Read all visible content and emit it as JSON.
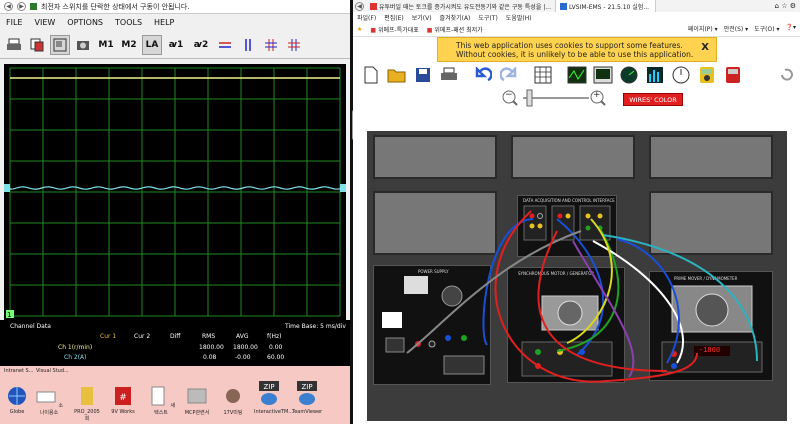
{
  "left_window": {
    "title": "최전자 스위치를 단락한 상태에서 구동이 안됩니다.",
    "menu": [
      "FILE",
      "VIEW",
      "OPTIONS",
      "TOOLS",
      "HELP"
    ],
    "toolbar": {
      "m1": "M1",
      "m2": "M2",
      "la": "LA",
      "i1": "ꜹ1",
      "i2": "ꜹ2"
    },
    "scope": {
      "trace_colors": {
        "ch1": "#f2f28a",
        "ch2": "#7fe0e8"
      },
      "grid_color": "#1e8a1e",
      "marker_label": "1"
    },
    "info": {
      "channel_data": "Channel Data",
      "time_base": "Time Base: 5 ms/div",
      "headers": [
        "Cur 1",
        "Cur 2",
        "Diff",
        "RMS",
        "AVG",
        "f(Hz)"
      ],
      "rows": [
        {
          "label": "Ch 1(r/min)",
          "rms": "1800.00",
          "avg": "1800.00",
          "f": "0.00"
        },
        {
          "label": "Ch 2(A)",
          "rms": "0.08",
          "avg": "-0.00",
          "f": "60.00"
        }
      ]
    },
    "desktop": {
      "top_labels": [
        "Intranet S...",
        "Visual Stud..."
      ],
      "icons": [
        "Globe",
        "소나이용소",
        "PRO_2005회",
        "9V Works",
        "새 텍스트",
        "MCP관련서",
        "17V미팅",
        "InteractiveTM...",
        "TeamViewer"
      ]
    }
  },
  "right_window": {
    "tabs": [
      {
        "label": "유투버일 때는 토크를 증가시켜도 유도전동기와 같은 구동 특성을 |..."
      },
      {
        "label": "LVSIM-EMS - 21.5.10 실험..."
      }
    ],
    "menu": [
      "파일(F)",
      "편집(E)",
      "보기(V)",
      "즐겨찾기(A)",
      "도구(T)",
      "도움말(H)"
    ],
    "favorites": [
      "위메프-특가대표",
      "위메프-패션 최저가"
    ],
    "right_tools": [
      "페이지(P) ▾",
      "안전(S) ▾",
      "도구(O) ▾",
      "❓▾"
    ],
    "cookie": {
      "text": "This web application uses cookies to support some features. Without cookies, it is unlikely to be able to use this application.",
      "close": "X"
    },
    "zoom": {
      "out": "−",
      "in": "+"
    },
    "wires_button": "WIRES' COLOR",
    "modules": {
      "power_supply": "POWER SUPPLY",
      "dai": "DATA ACQUISITION AND CONTROL INTERFACE",
      "motor": "SYNCHRONOUS MOTOR / GENERATOR",
      "dyno": "PRIME MOVER / DYNAMOMETER",
      "dyno_readout": "-1800"
    },
    "wire_colors": [
      "#1a4fd8",
      "#e02020",
      "#21a121",
      "#ffffff",
      "#888888",
      "#2bb3c0",
      "#d8d820",
      "#8a40b0"
    ]
  }
}
